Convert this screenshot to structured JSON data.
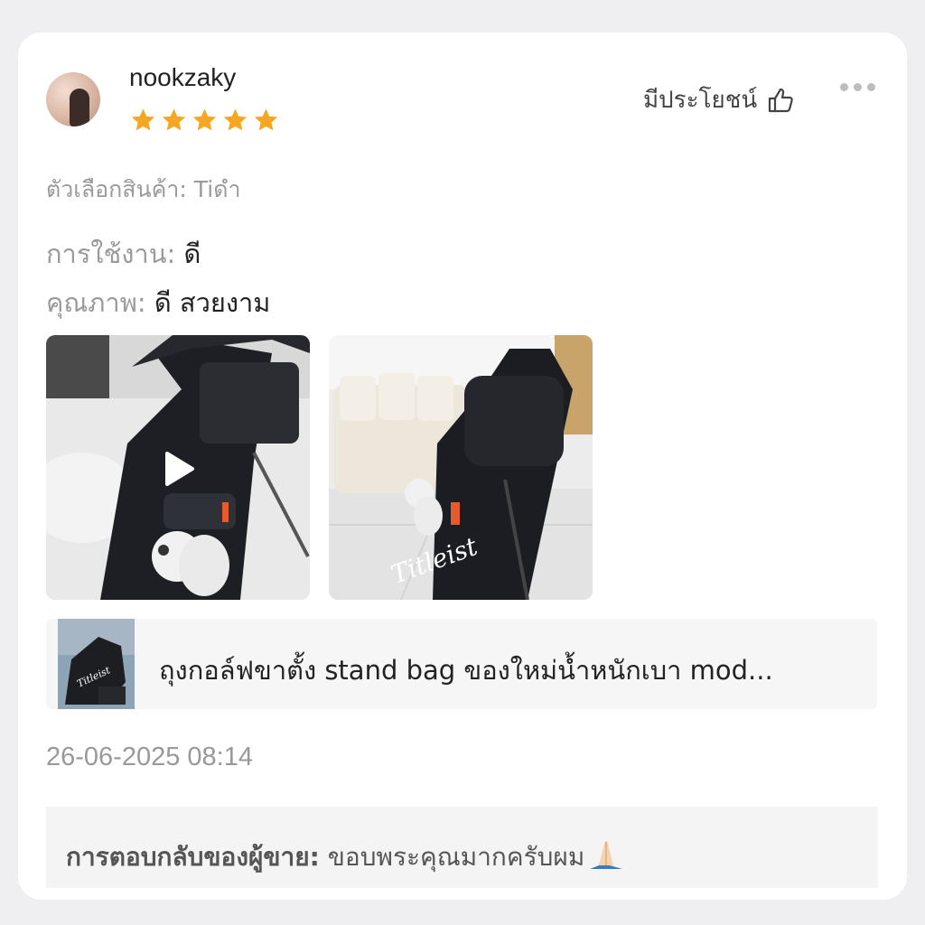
{
  "review": {
    "username": "nookzaky",
    "rating": 5,
    "helpful_label": "มีประโยชน์",
    "variant": "ตัวเลือกสินค้า: Tiดำ",
    "attributes": [
      {
        "label": "การใช้งาน:",
        "value": "ดี"
      },
      {
        "label": "คุณภาพ:",
        "value": "ดี สวยงาม"
      }
    ],
    "date": "26-06-2025 08:14"
  },
  "product": {
    "title": "ถุงกอล์ฟขาตั้ง stand bag ของใหม่น้ำหนักเบา mod..."
  },
  "seller_reply": {
    "label": "การตอบกลับของผู้ขาย:",
    "text": "ขอบพระคุณมากครับผม"
  },
  "colors": {
    "star": "#f5a623",
    "text": "#222222",
    "muted": "#9a9a9a"
  },
  "icons": [
    "avatar",
    "star-icon",
    "thumbs-up-icon",
    "more-icon",
    "play-icon",
    "praying-hands-emoji"
  ]
}
